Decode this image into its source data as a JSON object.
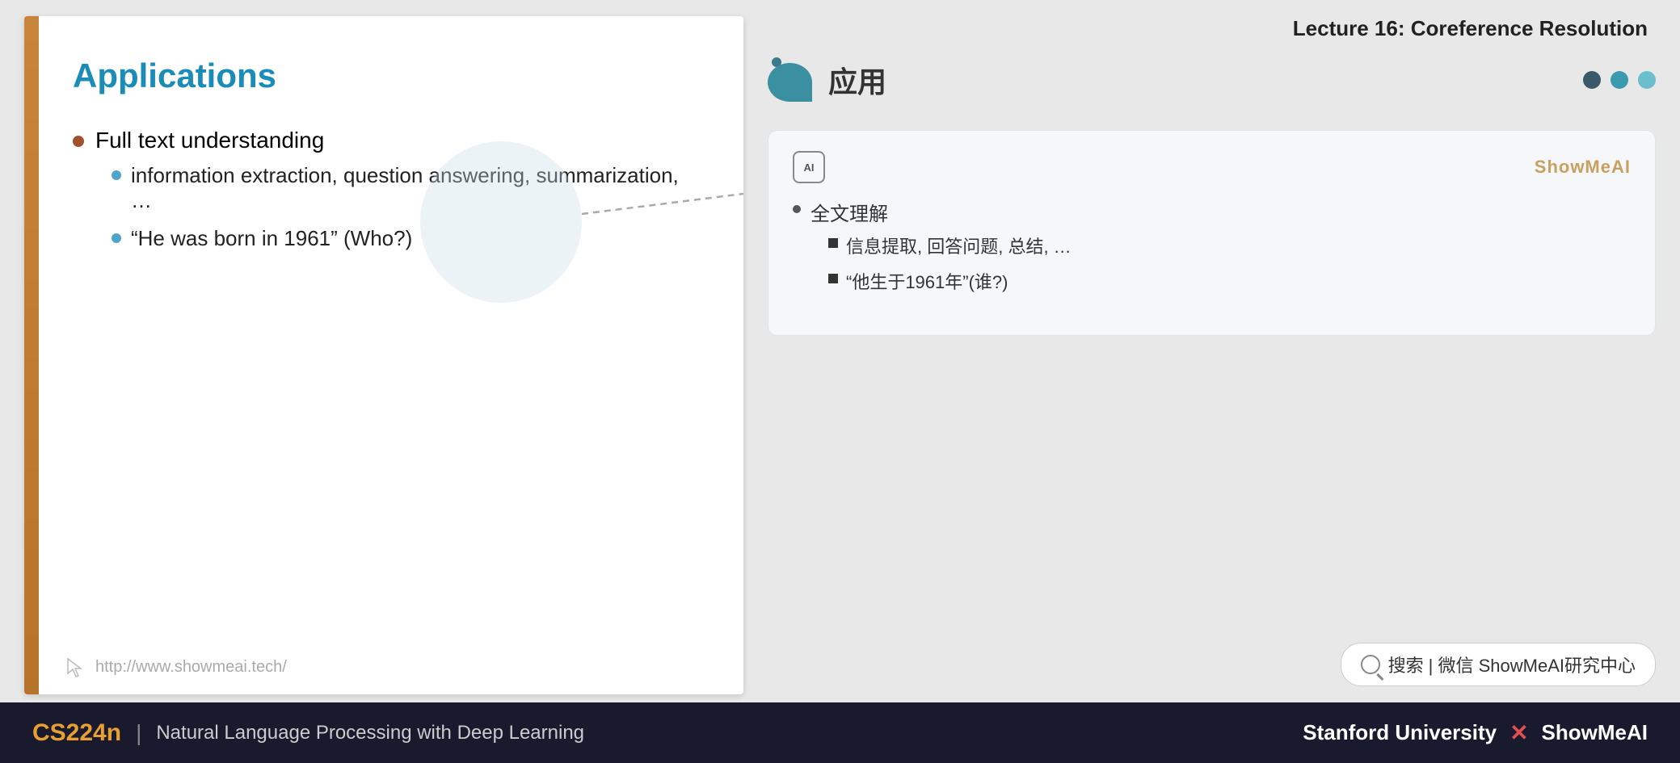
{
  "lecture": {
    "title": "Lecture 16: Coreference Resolution"
  },
  "slide": {
    "title": "Applications",
    "accent_color": "#c8843a",
    "bullets": [
      {
        "text": "Full text understanding",
        "sub_bullets": [
          "information extraction, question answering, summarization, …",
          "“He was born in 1961”        (Who?)"
        ]
      }
    ],
    "footer_url": "http://www.showmeai.tech/"
  },
  "right_panel": {
    "section_title_cn": "应用",
    "translation_card": {
      "brand": "ShowMeAI",
      "bullet_main": "全文理解",
      "sub_bullets": [
        "信息提取, 回答问题, 总结, …",
        "“他生于1961年”(谁?)"
      ]
    },
    "search_bar": {
      "text": "搜索 | 微信 ShowMeAI研究中心"
    },
    "nav_dots": [
      "dark",
      "teal",
      "light-teal"
    ]
  },
  "bottom_bar": {
    "cs224n": "CS224n",
    "pipe": "|",
    "course_name": "Natural Language Processing with Deep Learning",
    "university": "Stanford University",
    "x": "✕",
    "brand": "ShowMeAI"
  }
}
